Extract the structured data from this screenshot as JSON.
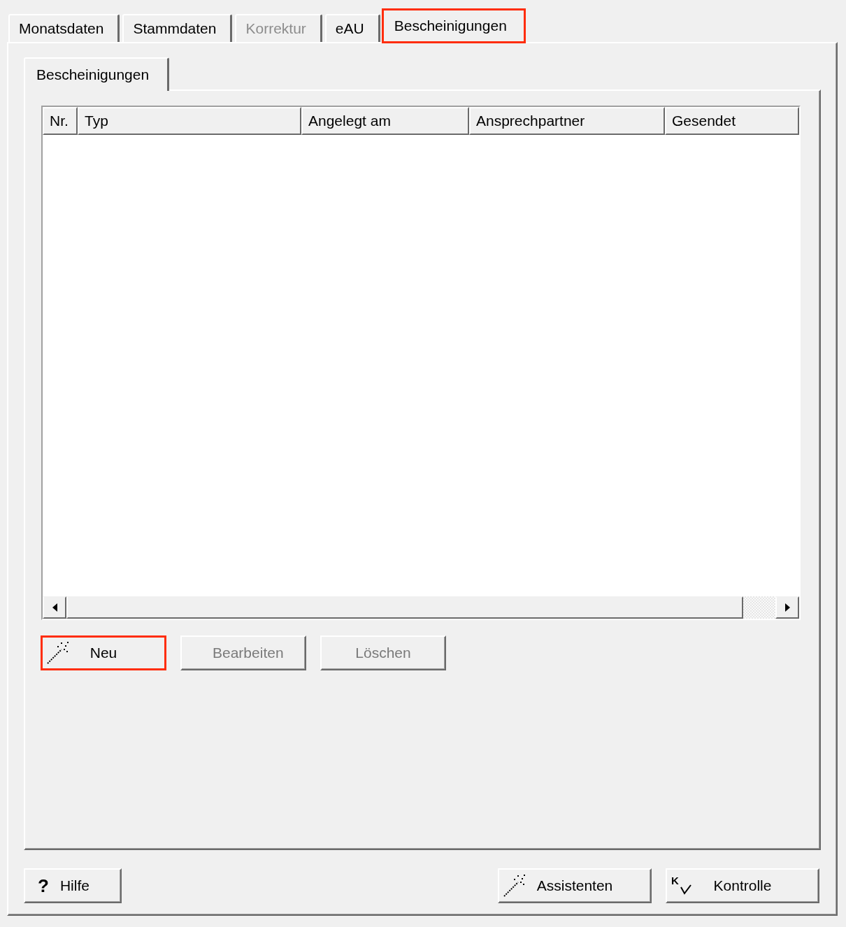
{
  "tabs": [
    {
      "label": "Monatsdaten",
      "selected": false,
      "disabled": false,
      "highlighted": false
    },
    {
      "label": "Stammdaten",
      "selected": false,
      "disabled": false,
      "highlighted": false
    },
    {
      "label": "Korrektur",
      "selected": false,
      "disabled": true,
      "highlighted": false
    },
    {
      "label": "eAU",
      "selected": false,
      "disabled": false,
      "highlighted": false
    },
    {
      "label": "Bescheinigungen",
      "selected": true,
      "disabled": false,
      "highlighted": true
    }
  ],
  "subtabs": [
    {
      "label": "Bescheinigungen",
      "selected": true
    }
  ],
  "table": {
    "columns": [
      "Nr.",
      "Typ",
      "Angelegt am",
      "Ansprechpartner",
      "Gesendet"
    ]
  },
  "actions": {
    "new_button": {
      "label": "Neu",
      "disabled": false,
      "highlighted": true
    },
    "edit_button": {
      "label": "Bearbeiten",
      "disabled": true,
      "highlighted": false
    },
    "delete_button": {
      "label": "Löschen",
      "disabled": true,
      "highlighted": false
    }
  },
  "footer": {
    "help_button": {
      "symbol": "?",
      "label": "Hilfe"
    },
    "assistant_button": {
      "label": "Assistenten"
    },
    "check_button": {
      "symbol": "K",
      "label": "Kontrolle"
    }
  }
}
